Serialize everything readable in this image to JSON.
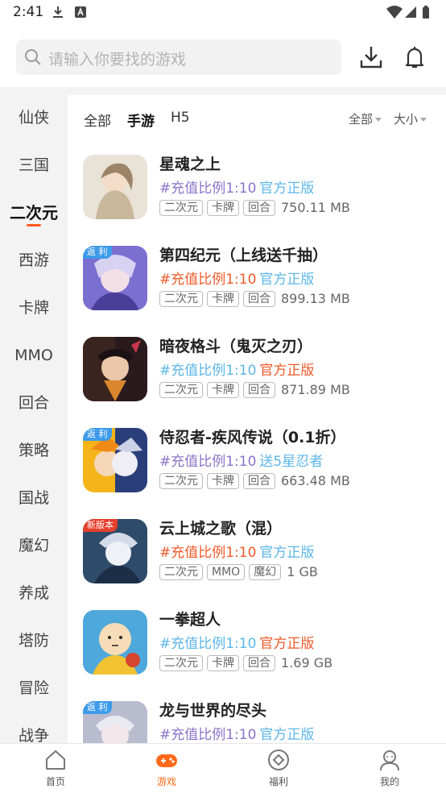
{
  "status": {
    "time": "2:41"
  },
  "search": {
    "placeholder": "请输入你要找的游戏"
  },
  "sidebar": {
    "items": [
      "仙侠",
      "三国",
      "二次元",
      "西游",
      "卡牌",
      "MMO",
      "回合",
      "策略",
      "国战",
      "魔幻",
      "养成",
      "塔防",
      "冒险",
      "战争"
    ],
    "active": "二次元"
  },
  "filters": {
    "tabs": [
      "全部",
      "手游",
      "H5"
    ],
    "active_tab": "手游",
    "dropdown_all": "全部",
    "dropdown_size": "大小"
  },
  "games": [
    {
      "title": "星魂之上",
      "promo_a": "#充值比例1:10",
      "promo_b": "官方正版",
      "tags": [
        "二次元",
        "卡牌",
        "回合"
      ],
      "size": "750.11 MB",
      "ribbon": ""
    },
    {
      "title": "第四纪元（上线送千抽）",
      "promo_a": "#充值比例1:10",
      "promo_b": "官方正版",
      "tags": [
        "二次元",
        "卡牌",
        "回合"
      ],
      "size": "899.13 MB",
      "ribbon": "返 利"
    },
    {
      "title": "暗夜格斗（鬼灭之刃）",
      "promo_a": "#充值比例1:10",
      "promo_b": "官方正版",
      "tags": [
        "二次元",
        "卡牌",
        "回合"
      ],
      "size": "871.89 MB",
      "ribbon": ""
    },
    {
      "title": "侍忍者-疾风传说（0.1折）",
      "promo_a": "#充值比例1:10",
      "promo_b": "送5星忍者",
      "tags": [
        "二次元",
        "卡牌",
        "回合"
      ],
      "size": "663.48 MB",
      "ribbon": "返 利"
    },
    {
      "title": "云上城之歌（混）",
      "promo_a": "#充值比例1:10",
      "promo_b": "官方正版",
      "tags": [
        "二次元",
        "MMO",
        "魔幻"
      ],
      "size": "1 GB",
      "ribbon": "新版本"
    },
    {
      "title": "一拳超人",
      "promo_a": "#充值比例1:10",
      "promo_b": "官方正版",
      "tags": [
        "二次元",
        "卡牌",
        "回合"
      ],
      "size": "1.69 GB",
      "ribbon": ""
    },
    {
      "title": "龙与世界的尽头",
      "promo_a": "#充值比例1:10",
      "promo_b": "官方正版",
      "tags": [],
      "size": "",
      "ribbon": "返 利"
    }
  ],
  "bottom_nav": [
    {
      "label": "首页",
      "icon": "home-icon"
    },
    {
      "label": "游戏",
      "icon": "gamepad-icon"
    },
    {
      "label": "福利",
      "icon": "gift-icon"
    },
    {
      "label": "我的",
      "icon": "profile-icon"
    }
  ],
  "colors": {
    "accent": "#ff6a1a",
    "promo_purple": "#8a74c9",
    "promo_orange": "#ef5a2a",
    "promo_blue": "#5cb6e8"
  }
}
